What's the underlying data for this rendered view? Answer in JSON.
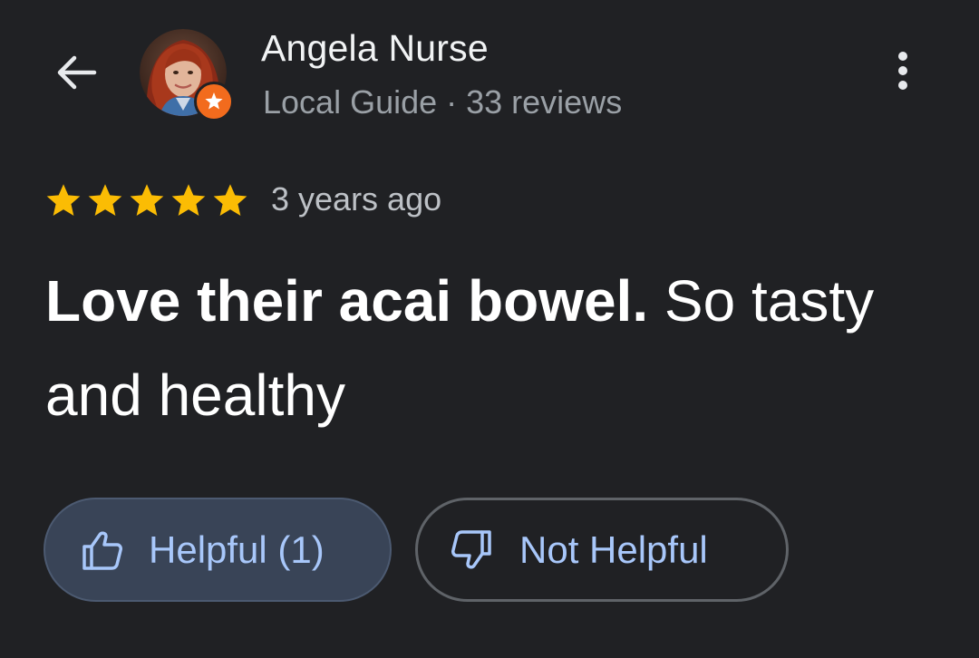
{
  "header": {
    "author_name": "Angela Nurse",
    "author_meta": "Local Guide · 33 reviews",
    "back_icon": "arrow-left-icon",
    "more_icon": "more-vert-icon",
    "badge_icon": "local-guide-star-icon"
  },
  "review": {
    "rating": 5,
    "rating_max": 5,
    "date": "3 years ago",
    "text_bold": "Love their acai bowel.",
    "text_rest": " So tasty and healthy"
  },
  "actions": {
    "helpful_label": "Helpful (1)",
    "not_helpful_label": "Not Helpful"
  },
  "colors": {
    "background": "#202124",
    "star": "#fbbc04",
    "badge": "#f26b1d",
    "button_text": "#a8c7fa",
    "helpful_bg": "#394457"
  }
}
